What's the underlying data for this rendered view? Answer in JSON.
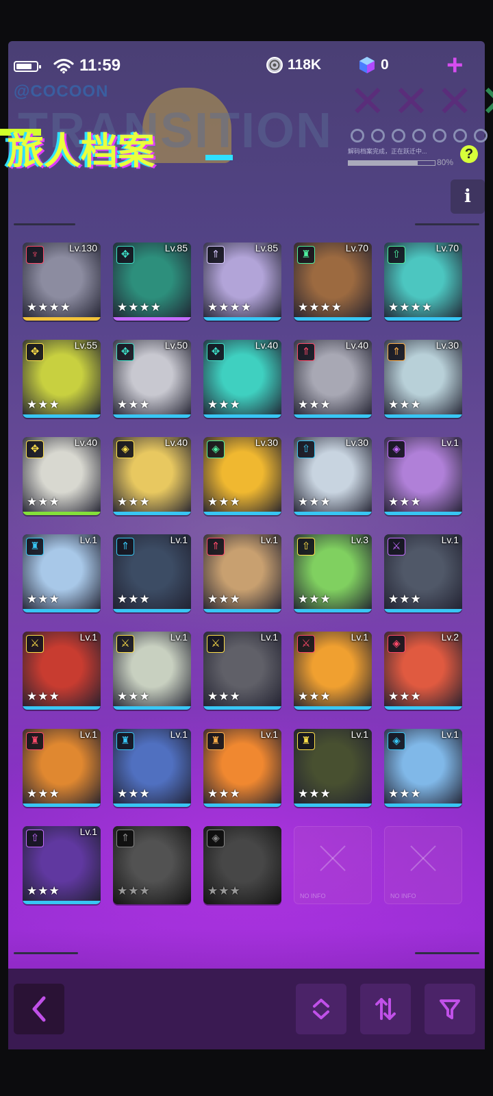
{
  "status_bar": {
    "time": "11:59"
  },
  "currency": {
    "coins": "118K",
    "gems": "0"
  },
  "banner": {
    "brand": "@COCOON",
    "bg_word": "TRANSITION",
    "title": "旅人档案",
    "status_text": "解码档案完成，正在跃迁中...",
    "progress": "80%",
    "help": "?"
  },
  "info_label": "i",
  "star_glyph": "★",
  "rarity_colors": {
    "gold": "#f2c23a",
    "purple": "#c46bff",
    "blue": "#38c6f4",
    "green": "#84e03a"
  },
  "characters": [
    {
      "level": "Lv.130",
      "stars": 4,
      "rarity": "gold",
      "cls": "♆",
      "cc": "#ff4a6a",
      "bg": "#8c8ca0",
      "icon": "spear-class-icon"
    },
    {
      "level": "Lv.85",
      "stars": 4,
      "rarity": "purple",
      "cls": "✥",
      "cc": "#3fe0c8",
      "bg": "#2d8f7c",
      "icon": "arrow-class-icon"
    },
    {
      "level": "Lv.85",
      "stars": 4,
      "rarity": "blue",
      "cls": "⇑",
      "cc": "#d8c8ff",
      "bg": "#b2a4d8",
      "icon": "up-arrow-class-icon"
    },
    {
      "level": "Lv.70",
      "stars": 4,
      "rarity": "blue",
      "cls": "♜",
      "cc": "#4ef0a0",
      "bg": "#9c6a40",
      "icon": "shield-class-icon"
    },
    {
      "level": "Lv.70",
      "stars": 4,
      "rarity": "blue",
      "cls": "⇧",
      "cc": "#4ef0a0",
      "bg": "#4cc6c0",
      "icon": "up-arrow-class-icon"
    },
    {
      "level": "Lv.55",
      "stars": 3,
      "rarity": "blue",
      "cls": "✥",
      "cc": "#ffe04a",
      "bg": "#c8d040",
      "icon": "arrow-class-icon"
    },
    {
      "level": "Lv.50",
      "stars": 3,
      "rarity": "blue",
      "cls": "✥",
      "cc": "#3fe0c8",
      "bg": "#c8c8d0",
      "icon": "arrow-class-icon"
    },
    {
      "level": "Lv.40",
      "stars": 3,
      "rarity": "blue",
      "cls": "✥",
      "cc": "#3fe0c8",
      "bg": "#3fd0c0",
      "icon": "arrow-class-icon"
    },
    {
      "level": "Lv.40",
      "stars": 3,
      "rarity": "blue",
      "cls": "⇑",
      "cc": "#ff4a6a",
      "bg": "#a8a8b4",
      "icon": "up-arrow-class-icon"
    },
    {
      "level": "Lv.30",
      "stars": 3,
      "rarity": "blue",
      "cls": "⇑",
      "cc": "#ffb04a",
      "bg": "#b8d0d8",
      "icon": "up-arrow-class-icon"
    },
    {
      "level": "Lv.40",
      "stars": 3,
      "rarity": "green",
      "cls": "✥",
      "cc": "#ffe04a",
      "bg": "#d8d8d0",
      "icon": "arrow-class-icon"
    },
    {
      "level": "Lv.40",
      "stars": 3,
      "rarity": "blue",
      "cls": "◈",
      "cc": "#ffe04a",
      "bg": "#e8c860",
      "icon": "diamond-class-icon"
    },
    {
      "level": "Lv.30",
      "stars": 3,
      "rarity": "blue",
      "cls": "◈",
      "cc": "#4ef0a0",
      "bg": "#f0b830",
      "icon": "diamond-class-icon"
    },
    {
      "level": "Lv.30",
      "stars": 3,
      "rarity": "blue",
      "cls": "⇧",
      "cc": "#38c6f4",
      "bg": "#c8d4e0",
      "icon": "up-arrow-class-icon"
    },
    {
      "level": "Lv.1",
      "stars": 3,
      "rarity": "blue",
      "cls": "◈",
      "cc": "#c46bff",
      "bg": "#b080d8",
      "icon": "diamond-class-icon"
    },
    {
      "level": "Lv.1",
      "stars": 3,
      "rarity": "blue",
      "cls": "♜",
      "cc": "#38c6f4",
      "bg": "#a8c8e8",
      "icon": "shield-class-icon"
    },
    {
      "level": "Lv.1",
      "stars": 3,
      "rarity": "blue",
      "cls": "⇑",
      "cc": "#38c6f4",
      "bg": "#3c4c64",
      "icon": "up-arrow-class-icon"
    },
    {
      "level": "Lv.1",
      "stars": 3,
      "rarity": "blue",
      "cls": "⇑",
      "cc": "#ff4a6a",
      "bg": "#c8a070",
      "icon": "up-arrow-class-icon"
    },
    {
      "level": "Lv.3",
      "stars": 3,
      "rarity": "blue",
      "cls": "⇧",
      "cc": "#ffe04a",
      "bg": "#80d060",
      "icon": "up-arrow-class-icon"
    },
    {
      "level": "Lv.1",
      "stars": 3,
      "rarity": "blue",
      "cls": "⚔",
      "cc": "#c46bff",
      "bg": "#505868",
      "icon": "swords-class-icon"
    },
    {
      "level": "Lv.1",
      "stars": 3,
      "rarity": "blue",
      "cls": "⚔",
      "cc": "#ffe04a",
      "bg": "#c83c30",
      "icon": "swords-class-icon"
    },
    {
      "level": "Lv.1",
      "stars": 3,
      "rarity": "blue",
      "cls": "⚔",
      "cc": "#ffe04a",
      "bg": "#c8d0c0",
      "icon": "swords-class-icon"
    },
    {
      "level": "Lv.1",
      "stars": 3,
      "rarity": "blue",
      "cls": "⚔",
      "cc": "#ffe04a",
      "bg": "#606068",
      "icon": "swords-class-icon"
    },
    {
      "level": "Lv.1",
      "stars": 3,
      "rarity": "blue",
      "cls": "⚔",
      "cc": "#ff4a6a",
      "bg": "#f0a030",
      "icon": "swords-class-icon"
    },
    {
      "level": "Lv.2",
      "stars": 3,
      "rarity": "blue",
      "cls": "◈",
      "cc": "#ff4a6a",
      "bg": "#e05a40",
      "icon": "diamond-class-icon"
    },
    {
      "level": "Lv.1",
      "stars": 3,
      "rarity": "blue",
      "cls": "♜",
      "cc": "#ff4a6a",
      "bg": "#e08830",
      "icon": "shield-class-icon"
    },
    {
      "level": "Lv.1",
      "stars": 3,
      "rarity": "blue",
      "cls": "♜",
      "cc": "#38c6f4",
      "bg": "#5070c0",
      "icon": "shield-class-icon"
    },
    {
      "level": "Lv.1",
      "stars": 3,
      "rarity": "blue",
      "cls": "♜",
      "cc": "#ffb04a",
      "bg": "#f08830",
      "icon": "shield-class-icon"
    },
    {
      "level": "Lv.1",
      "stars": 3,
      "rarity": "blue",
      "cls": "♜",
      "cc": "#ffe04a",
      "bg": "#485030",
      "icon": "shield-class-icon"
    },
    {
      "level": "Lv.1",
      "stars": 3,
      "rarity": "blue",
      "cls": "◈",
      "cc": "#38c6f4",
      "bg": "#80b8e8",
      "icon": "diamond-class-icon"
    },
    {
      "level": "Lv.1",
      "stars": 3,
      "rarity": "blue",
      "cls": "⇧",
      "cc": "#c46bff",
      "bg": "#6038a0",
      "icon": "up-arrow-class-icon"
    },
    {
      "level": "",
      "stars": 3,
      "rarity": "none",
      "cls": "⇑",
      "cc": "#dddddd",
      "bg": "#888888",
      "locked": true,
      "icon": "up-arrow-class-icon"
    },
    {
      "level": "",
      "stars": 3,
      "rarity": "none",
      "cls": "◈",
      "cc": "#dddddd",
      "bg": "#777777",
      "locked": true,
      "icon": "diamond-class-icon"
    }
  ],
  "empty_slot_label": "NO INFO"
}
